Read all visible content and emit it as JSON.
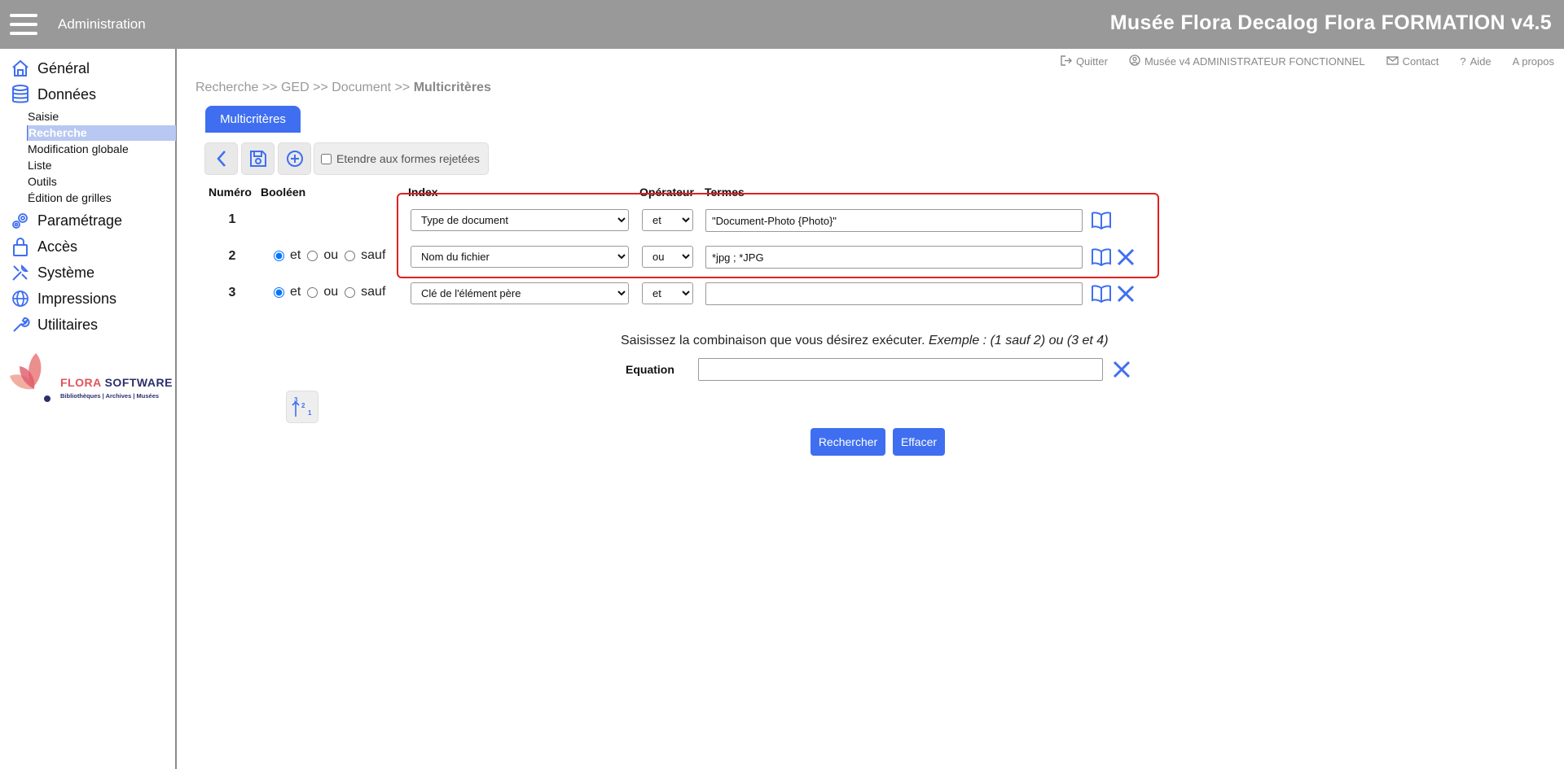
{
  "header": {
    "menu_label": "Administration",
    "app_title": "Musée Flora Decalog Flora FORMATION v4.5"
  },
  "sidebar": {
    "items": [
      {
        "label": "Général",
        "icon": "home-icon"
      },
      {
        "label": "Données",
        "icon": "database-icon"
      },
      {
        "label": "Paramétrage",
        "icon": "gears-icon"
      },
      {
        "label": "Accès",
        "icon": "lock-icon"
      },
      {
        "label": "Système",
        "icon": "tools-icon"
      },
      {
        "label": "Impressions",
        "icon": "globe-icon"
      },
      {
        "label": "Utilitaires",
        "icon": "wrench-icon"
      }
    ],
    "sub_items": [
      {
        "label": "Saisie"
      },
      {
        "label": "Recherche",
        "active": true
      },
      {
        "label": "Modification globale"
      },
      {
        "label": "Liste"
      },
      {
        "label": "Outils"
      },
      {
        "label": "Édition de grilles"
      }
    ],
    "logo": {
      "brand_a": "FLORA",
      "brand_b": "SOFTWARE",
      "tagline": "Bibliothèques | Archives | Musées"
    }
  },
  "top_links": {
    "quit": "Quitter",
    "user": "Musée v4 ADMINISTRATEUR FONCTIONNEL",
    "contact": "Contact",
    "help": "Aide",
    "about": "A propos"
  },
  "breadcrumb": {
    "path": "Recherche >> GED >> Document >> ",
    "current": "Multicritères"
  },
  "tab": {
    "label": "Multicritères"
  },
  "toolbar": {
    "extend_label": "Etendre aux formes rejetées"
  },
  "columns": {
    "numero": "Numéro",
    "booleen": "Booléen",
    "index": "Index",
    "operateur": "Opérateur",
    "termes": "Termes"
  },
  "bool_labels": {
    "et": "et",
    "ou": "ou",
    "sauf": "sauf"
  },
  "rows": [
    {
      "num": "1",
      "index": "Type de document",
      "operator": "et",
      "term": "\"Document-Photo {Photo}\""
    },
    {
      "num": "2",
      "bool": "et",
      "index": "Nom du fichier",
      "operator": "ou",
      "term": "*jpg ; *JPG"
    },
    {
      "num": "3",
      "bool": "et",
      "index": "Clé de l'élément père",
      "operator": "et",
      "term": ""
    }
  ],
  "equation": {
    "hint_text": "Saisissez la combinaison que vous désirez exécuter. ",
    "hint_example": "Exemple : (1 sauf 2) ou (3 et 4)",
    "label": "Equation",
    "value": ""
  },
  "sort_button": {
    "label": "321"
  },
  "actions": {
    "search": "Rechercher",
    "clear": "Effacer"
  },
  "colors": {
    "accent": "#3f6ff0",
    "header_bg": "#999999",
    "highlight": "#e02020",
    "active_nav_bg": "#b8c8f2"
  }
}
